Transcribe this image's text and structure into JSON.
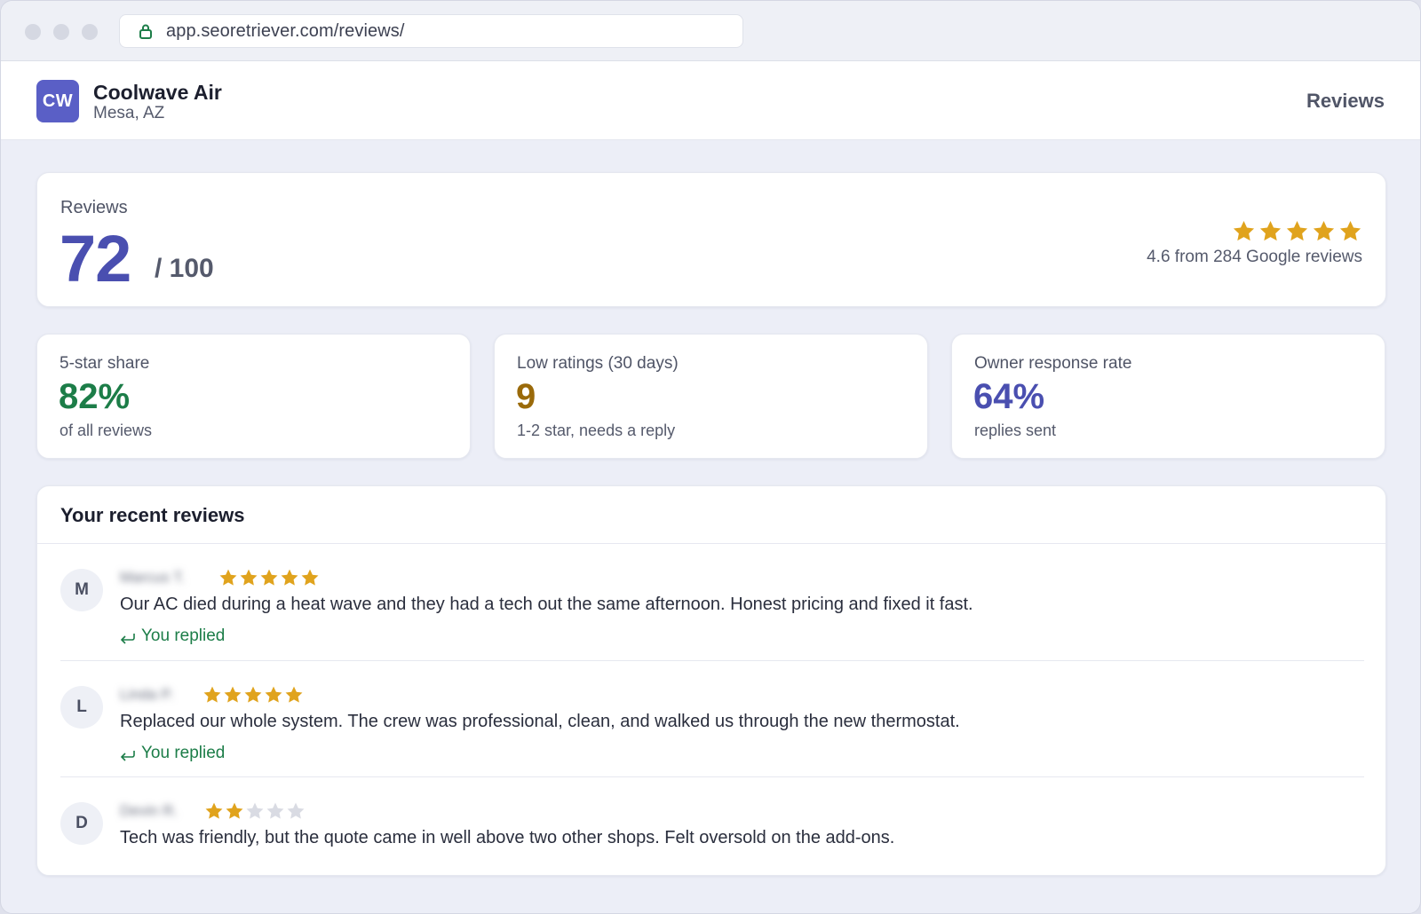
{
  "browser": {
    "url": "app.seoretriever.com/reviews/"
  },
  "header": {
    "logo_initials": "CW",
    "business_name": "Coolwave Air",
    "location": "Mesa, AZ",
    "nav_label": "Reviews"
  },
  "score": {
    "label": "Reviews",
    "value": "72",
    "max": "/ 100",
    "rating_summary": "4.6 from 284 Google reviews",
    "stars_filled": 5
  },
  "metrics": [
    {
      "label": "5-star share",
      "value": "82%",
      "sub": "of all reviews",
      "color": "#1c7d48"
    },
    {
      "label": "Low ratings (30 days)",
      "value": "9",
      "sub": "1-2 star, needs a reply",
      "color": "#9a6a0a"
    },
    {
      "label": "Owner response rate",
      "value": "64%",
      "sub": "replies sent",
      "color": "#4a4fb0"
    }
  ],
  "recent": {
    "title": "Your recent reviews",
    "items": [
      {
        "initial": "M",
        "name": "Marcus T.",
        "stars": 5,
        "text": "Our AC died during a heat wave and they had a tech out the same afternoon. Honest pricing and fixed it fast.",
        "reply_label": "You replied"
      },
      {
        "initial": "L",
        "name": "Linda P.",
        "stars": 5,
        "text": "Replaced our whole system. The crew was professional, clean, and walked us through the new thermostat.",
        "reply_label": "You replied"
      },
      {
        "initial": "D",
        "name": "Devin R.",
        "stars": 2,
        "text": "Tech was friendly, but the quote came in well above two other shops. Felt oversold on the add-ons."
      }
    ]
  },
  "colors": {
    "star_filled": "#e0a31d",
    "star_empty": "#d9dbe3",
    "brand": "#5a5fc6"
  },
  "icons": {
    "lock": "lock-icon",
    "star": "star-icon",
    "reply": "reply-arrow-icon"
  }
}
